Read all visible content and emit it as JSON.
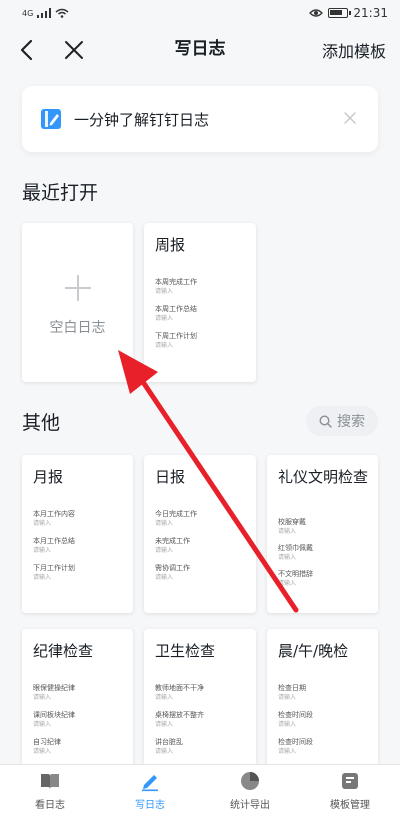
{
  "status_bar": {
    "network": "4G",
    "time": "21:31"
  },
  "header": {
    "title": "写日志",
    "add_template": "添加模板"
  },
  "tip": {
    "text": "一分钟了解钉钉日志",
    "accent": "#3296fa"
  },
  "recent": {
    "title": "最近打开",
    "blank_label": "空白日志",
    "cards": [
      {
        "title": "周报",
        "fields": [
          {
            "label": "本周完成工作",
            "hint": "请输入"
          },
          {
            "label": "本周工作总结",
            "hint": "请输入"
          },
          {
            "label": "下周工作计划",
            "hint": "请输入"
          }
        ]
      }
    ]
  },
  "others": {
    "title": "其他",
    "search_label": "搜索",
    "cards": [
      {
        "title": "月报",
        "fields": [
          {
            "label": "本月工作内容",
            "hint": "请输入"
          },
          {
            "label": "本月工作总结",
            "hint": "请输入"
          },
          {
            "label": "下月工作计划",
            "hint": "请输入"
          }
        ]
      },
      {
        "title": "日报",
        "fields": [
          {
            "label": "今日完成工作",
            "hint": "请输入"
          },
          {
            "label": "未完成工作",
            "hint": "请输入"
          },
          {
            "label": "需协调工作",
            "hint": "请输入"
          }
        ]
      },
      {
        "title": "礼仪文明检查",
        "fields": [
          {
            "label": "校服穿戴",
            "hint": "请输入"
          },
          {
            "label": "红领巾佩戴",
            "hint": "请输入"
          },
          {
            "label": "不文明措辞",
            "hint": "请输入"
          }
        ]
      },
      {
        "title": "纪律检查",
        "fields": [
          {
            "label": "眼保健操纪律",
            "hint": "请输入"
          },
          {
            "label": "课间板块纪律",
            "hint": "请输入"
          },
          {
            "label": "自习纪律",
            "hint": "请输入"
          }
        ]
      },
      {
        "title": "卫生检查",
        "fields": [
          {
            "label": "教师地面不干净",
            "hint": "请输入"
          },
          {
            "label": "桌椅摆放不整齐",
            "hint": "请输入"
          },
          {
            "label": "讲台脏乱",
            "hint": "请输入"
          }
        ]
      },
      {
        "title": "晨/午/晚检",
        "fields": [
          {
            "label": "检查日期",
            "hint": "请输入"
          },
          {
            "label": "检查时间段",
            "hint": "请输入"
          },
          {
            "label": "检查时间段",
            "hint": "请输入"
          }
        ]
      }
    ]
  },
  "tabbar": {
    "tabs": [
      {
        "label": "看日志",
        "icon": "book-icon",
        "active": false
      },
      {
        "label": "写日志",
        "icon": "pen-icon",
        "active": true
      },
      {
        "label": "统计导出",
        "icon": "pie-chart-icon",
        "active": false
      },
      {
        "label": "模板管理",
        "icon": "template-icon",
        "active": false
      }
    ]
  },
  "colors": {
    "accent": "#3296fa",
    "annotation_arrow": "#e8202a"
  }
}
